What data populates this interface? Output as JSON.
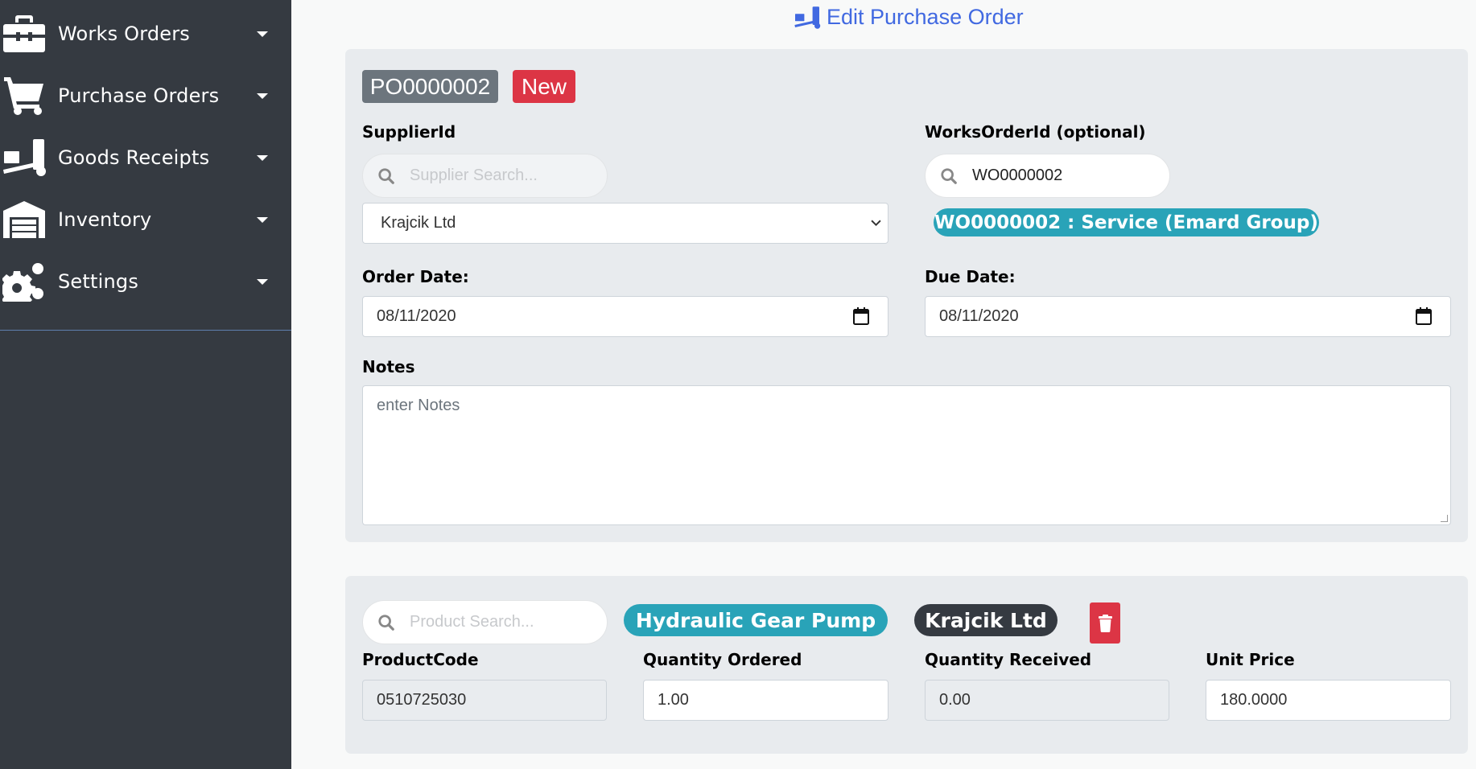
{
  "sidebar": {
    "items": [
      {
        "label": "Works Orders",
        "icon": "toolbox-icon"
      },
      {
        "label": "Purchase Orders",
        "icon": "cart-icon"
      },
      {
        "label": "Goods Receipts",
        "icon": "dolly-icon"
      },
      {
        "label": "Inventory",
        "icon": "warehouse-icon"
      },
      {
        "label": "Settings",
        "icon": "cogs-icon"
      }
    ]
  },
  "header": {
    "title": "Edit Purchase Order",
    "icon": "dolly-icon"
  },
  "order": {
    "number": "PO0000002",
    "status": "New",
    "supplier_label": "SupplierId",
    "supplier_search_placeholder": "Supplier Search...",
    "supplier_selected": "Krajcik Ltd",
    "works_order_label": "WorksOrderId (optional)",
    "works_order_search_value": "WO0000002",
    "works_order_badge": "WO0000002 : Service (Emard Group)",
    "order_date_label": "Order Date:",
    "order_date": "08/11/2020",
    "due_date_label": "Due Date:",
    "due_date": "08/11/2020",
    "notes_label": "Notes",
    "notes_placeholder": "enter Notes"
  },
  "line": {
    "product_search_placeholder": "Product Search...",
    "product_name": "Hydraulic Gear Pump",
    "supplier_name": "Krajcik Ltd",
    "product_code_label": "ProductCode",
    "product_code": "0510725030",
    "qty_ordered_label": "Quantity Ordered",
    "qty_ordered": "1.00",
    "qty_received_label": "Quantity Received",
    "qty_received": "0.00",
    "unit_price_label": "Unit Price",
    "unit_price": "180.0000"
  },
  "colors": {
    "sidebar_bg": "#353a41",
    "accent_blue": "#4169e1",
    "badge_grey": "#6c757d",
    "badge_red": "#dc3545",
    "pill_teal": "#29a3b8"
  }
}
